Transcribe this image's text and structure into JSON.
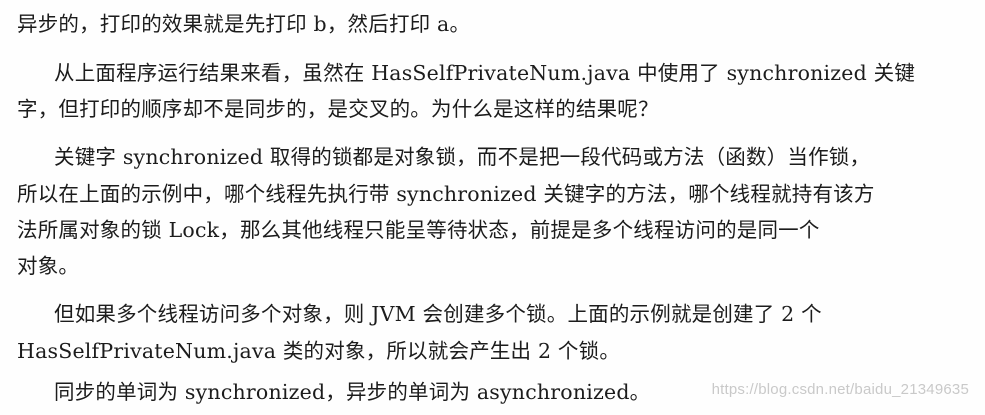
{
  "document": {
    "lines": [
      "异步的，打印的效果就是先打印 b，然后打印 a。",
      "从上面程序运行结果来看，虽然在 HasSelfPrivateNum.java 中使用了 synchronized 关键",
      "字，但打印的顺序却不是同步的，是交叉的。为什么是这样的结果呢？",
      "关键字 synchronized 取得的锁都是对象锁，而不是把一段代码或方法（函数）当作锁，",
      "所以在上面的示例中，哪个线程先执行带 synchronized 关键字的方法，哪个线程就持有该方",
      "法所属对象的锁 Lock，那么其他线程只能呈等待状态，前提是多个线程访问的是同一个",
      "对象。",
      "但如果多个线程访问多个对象，则 JVM 会创建多个锁。上面的示例就是创建了 2 个",
      "HasSelfPrivateNum.java 类的对象，所以就会产生出 2 个锁。",
      "同步的单词为 synchronized，异步的单词为 asynchronized。"
    ]
  },
  "watermark": {
    "text": "https://blog.csdn.net/baidu_21349635"
  }
}
